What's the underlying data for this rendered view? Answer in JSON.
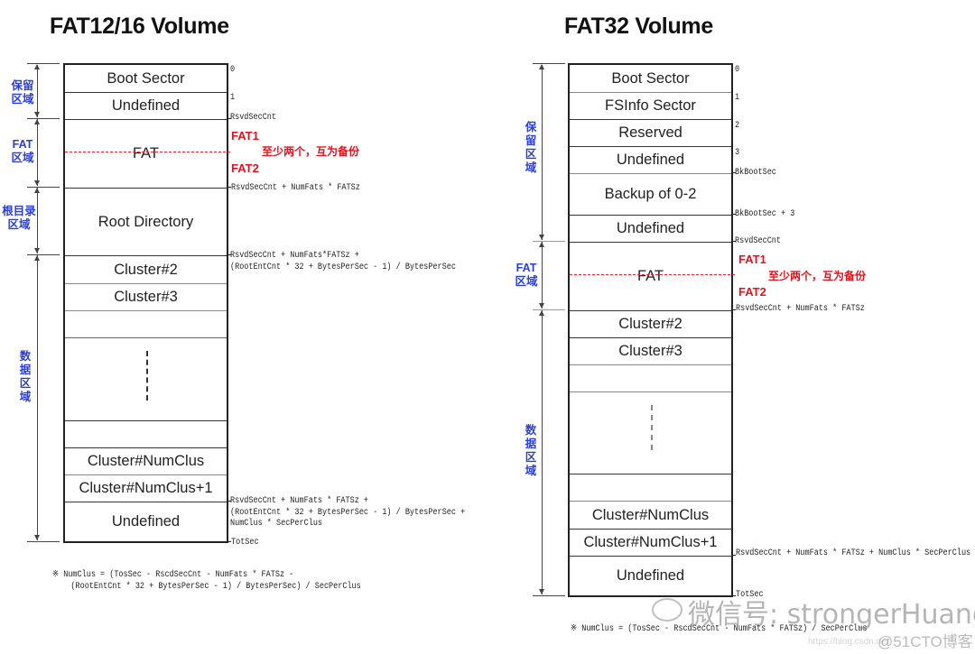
{
  "left": {
    "title": "FAT12/16 Volume",
    "rows": [
      "Boot Sector",
      "Undefined",
      "FAT",
      "Root Directory",
      "Cluster#2",
      "Cluster#3",
      "",
      "",
      "",
      "Cluster#NumClus",
      "Cluster#NumClus+1",
      "Undefined"
    ],
    "offsets": {
      "o0": "0",
      "o1": "1",
      "o2": "RsvdSecCnt",
      "o3": "RsvdSecCnt + NumFats * FATSz",
      "o4": "RsvdSecCnt + NumFats*FATSz +\n(RootEntCnt * 32 + BytesPerSec - 1) / BytesPerSec",
      "o5": "RsvdSecCnt + NumFats * FATSz +\n(RootEntCnt * 32 + BytesPerSec - 1) / BytesPerSec +\nNumClus * SecPerClus",
      "o6": "TotSec"
    },
    "fat1": "FAT1",
    "fat2": "FAT2",
    "fat_note": "至少两个，互为备份",
    "regions": {
      "reserved": "保留\n区域",
      "fat": "FAT\n区域",
      "root": "根目录\n区域",
      "data": "数\n据\n区\n域"
    },
    "footnote": "※ NumClus = (TosSec - RscdSecCnt - NumFats * FATSz -\n    (RootEntCnt * 32 + BytesPerSec - 1) / BytesPerSec) / SecPerClus"
  },
  "right": {
    "title": "FAT32 Volume",
    "rows": [
      "Boot Sector",
      "FSInfo Sector",
      "Reserved",
      "Undefined",
      "Backup of 0-2",
      "Undefined",
      "FAT",
      "Cluster#2",
      "Cluster#3",
      "",
      "",
      "",
      "Cluster#NumClus",
      "Cluster#NumClus+1",
      "Undefined"
    ],
    "offsets": {
      "o0": "0",
      "o1": "1",
      "o2": "2",
      "o3": "3",
      "o4": "BkBootSec",
      "o5": "BkBootSec + 3",
      "o6": "RsvdSecCnt",
      "o7": "RsvdSecCnt + NumFats * FATSz",
      "o8": "RsvdSecCnt + NumFats * FATSz + NumClus * SecPerClus",
      "o9": "TotSec"
    },
    "fat1": "FAT1",
    "fat2": "FAT2",
    "fat_note": "至少两个，互为备份",
    "regions": {
      "reserved": "保\n留\n区\n域",
      "fat": "FAT\n区域",
      "data": "数\n据\n区\n域"
    },
    "footnote": "※ NumClus = (TosSec - RscdSecCnt - NumFats * FATSz) / SecPerClus"
  },
  "watermark": {
    "main": "微信号: strongerHuang",
    "brand": "@51CTO博客",
    "url": "https://blog.csdn.net"
  },
  "colors": {
    "region_label": "#2a3fd6",
    "fat_annotation": "#e0141e"
  }
}
